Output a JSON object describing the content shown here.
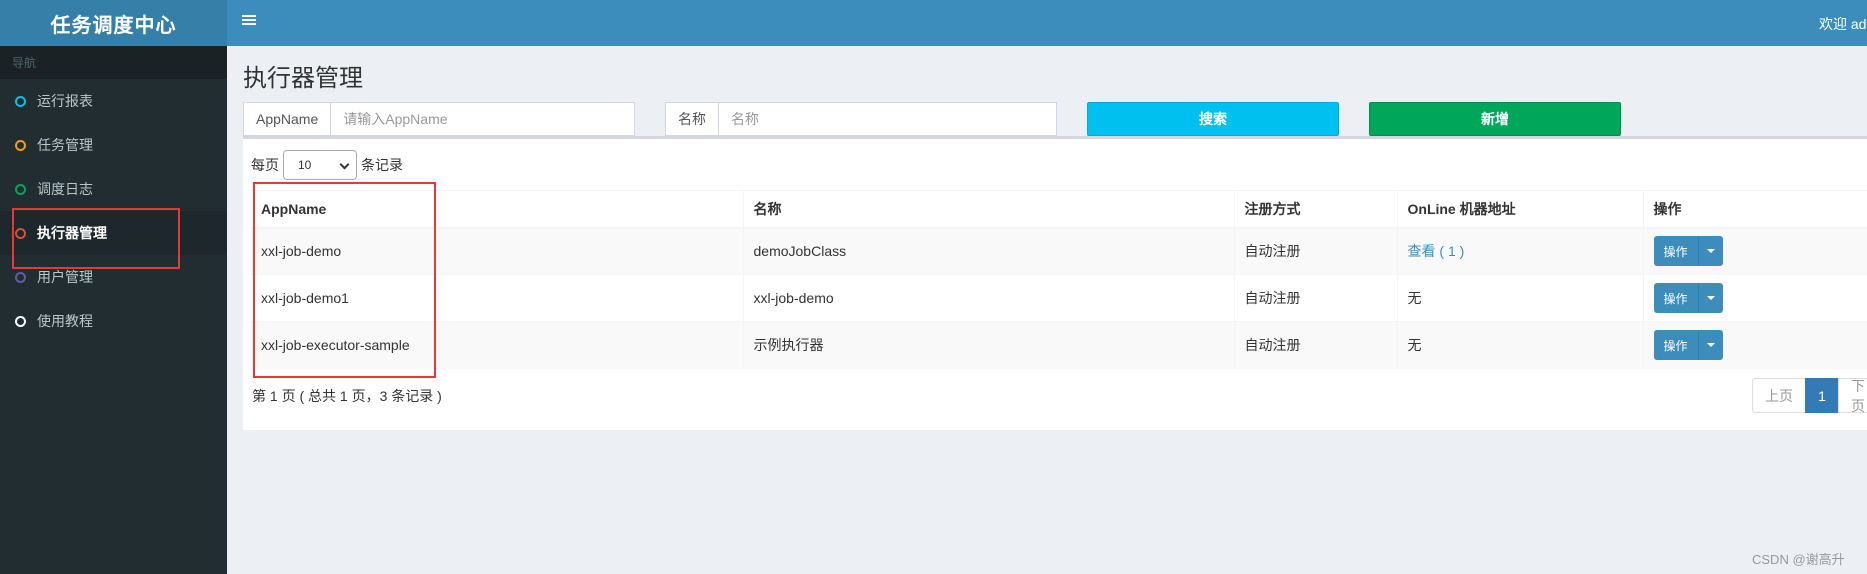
{
  "brand": {
    "title": "任务调度中心"
  },
  "sidebar": {
    "header": "导航",
    "items": [
      {
        "label": "运行报表",
        "color": "#00c0ef"
      },
      {
        "label": "任务管理",
        "color": "#f39c12"
      },
      {
        "label": "调度日志",
        "color": "#00a65a"
      },
      {
        "label": "执行器管理",
        "color": "#dd4b39"
      },
      {
        "label": "用户管理",
        "color": "#605ca8"
      },
      {
        "label": "使用教程",
        "color": "#ffffff"
      }
    ],
    "active_index": 3
  },
  "header": {
    "welcome": "欢迎 adı"
  },
  "page": {
    "title": "执行器管理",
    "filters": {
      "appname_label": "AppName",
      "appname_placeholder": "请输入AppName",
      "name_label": "名称",
      "name_placeholder": "名称"
    },
    "search_label": "搜索",
    "add_label": "新增"
  },
  "table": {
    "length_prefix": "每页",
    "length_value": "10",
    "length_suffix": "条记录",
    "columns": [
      "AppName",
      "名称",
      "注册方式",
      "OnLine 机器地址",
      "操作"
    ],
    "rows": [
      {
        "appname": "xxl-job-demo",
        "name": "demoJobClass",
        "reg": "自动注册",
        "online": "查看 ( 1 )",
        "online_link": true,
        "op": "操作"
      },
      {
        "appname": "xxl-job-demo1",
        "name": "xxl-job-demo",
        "reg": "自动注册",
        "online": "无",
        "online_link": false,
        "op": "操作"
      },
      {
        "appname": "xxl-job-executor-sample",
        "name": "示例执行器",
        "reg": "自动注册",
        "online": "无",
        "online_link": false,
        "op": "操作"
      }
    ],
    "info": "第 1 页 ( 总共 1 页，3 条记录 )",
    "pagination": {
      "prev": "上页",
      "current": "1",
      "next": "下页"
    }
  },
  "watermark": "CSDN @谢高升"
}
